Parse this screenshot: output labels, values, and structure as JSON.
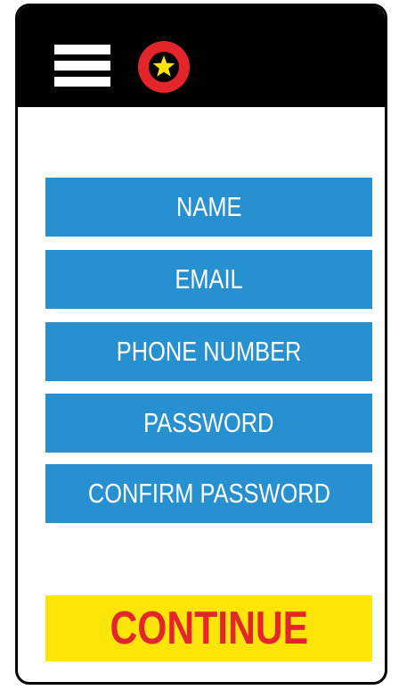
{
  "header": {
    "menu_icon": "hamburger-menu-icon",
    "logo_icon": "star-logo-icon",
    "colors": {
      "bar": "#000000",
      "logo_ring": "#e3262b",
      "logo_center": "#000000",
      "logo_star": "#fde509"
    }
  },
  "form": {
    "fields": [
      {
        "label": "NAME"
      },
      {
        "label": "EMAIL"
      },
      {
        "label": "PHONE NUMBER"
      },
      {
        "label": "PASSWORD"
      },
      {
        "label": "CONFIRM PASSWORD"
      }
    ],
    "field_color": "#2790d1"
  },
  "continue_button": {
    "label": "CONTINUE",
    "background": "#fde509",
    "text_color": "#e3262b"
  }
}
